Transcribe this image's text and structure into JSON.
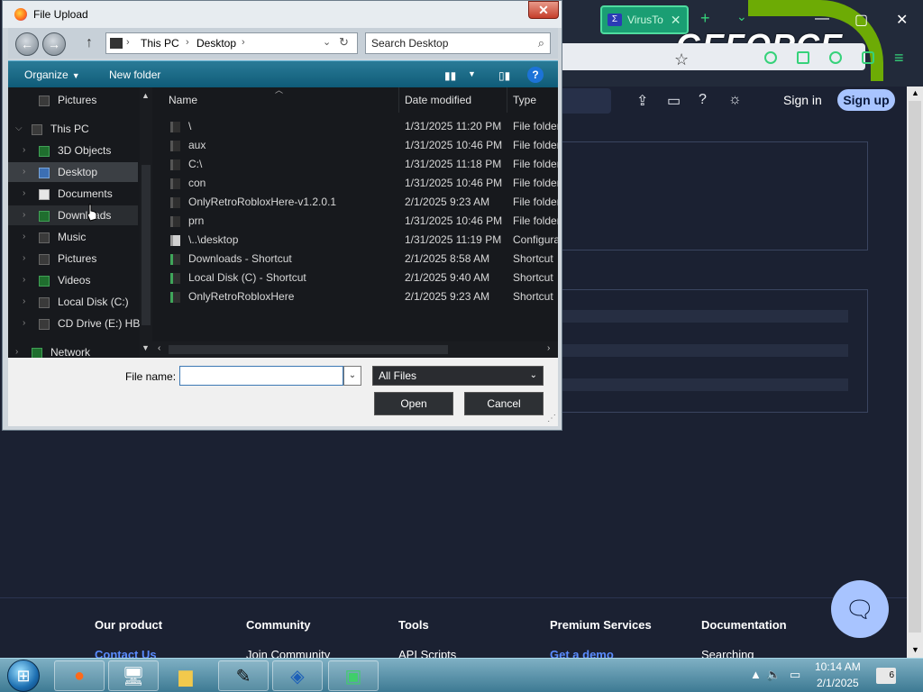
{
  "browser": {
    "tab_label": "VirusTo",
    "brand_text": "GEFORCE",
    "nav": {
      "sign_in": "Sign in",
      "sign_up": "Sign up"
    },
    "footer": {
      "columns": [
        {
          "heading": "Our product",
          "link": "Contact Us",
          "link_style": "blue"
        },
        {
          "heading": "Community",
          "link": "Join Community",
          "link_style": "white"
        },
        {
          "heading": "Tools",
          "link": "API Scripts",
          "link_style": "white"
        },
        {
          "heading": "Premium Services",
          "link": "Get a demo",
          "link_style": "blue"
        },
        {
          "heading": "Documentation",
          "link": "Searching",
          "link_style": "white"
        }
      ]
    }
  },
  "dialog": {
    "title": "File Upload",
    "path": [
      "This PC",
      "Desktop"
    ],
    "search_placeholder": "Search Desktop",
    "toolbar": {
      "organize": "Organize",
      "new_folder": "New folder"
    },
    "nav_tree": [
      {
        "label": "Pictures",
        "icon": "pictures-folder-icon",
        "level": 1,
        "chevron": false,
        "state": ""
      },
      {
        "label": "This PC",
        "icon": "computer-icon",
        "level": 0,
        "chevron": "v",
        "state": ""
      },
      {
        "label": "3D Objects",
        "icon": "3d-objects-icon",
        "level": 1,
        "chevron": ">",
        "state": ""
      },
      {
        "label": "Desktop",
        "icon": "desktop-icon",
        "level": 1,
        "chevron": ">",
        "state": "selected"
      },
      {
        "label": "Documents",
        "icon": "documents-icon",
        "level": 1,
        "chevron": ">",
        "state": ""
      },
      {
        "label": "Downloads",
        "icon": "downloads-icon",
        "level": 1,
        "chevron": ">",
        "state": "hover"
      },
      {
        "label": "Music",
        "icon": "music-icon",
        "level": 1,
        "chevron": ">",
        "state": ""
      },
      {
        "label": "Pictures",
        "icon": "pictures-folder-icon",
        "level": 1,
        "chevron": ">",
        "state": ""
      },
      {
        "label": "Videos",
        "icon": "videos-icon",
        "level": 1,
        "chevron": ">",
        "state": ""
      },
      {
        "label": "Local Disk (C:)",
        "icon": "disk-icon",
        "level": 1,
        "chevron": ">",
        "state": ""
      },
      {
        "label": "CD Drive (E:) HB",
        "icon": "cd-drive-icon",
        "level": 1,
        "chevron": ">",
        "state": ""
      },
      {
        "label": "Network",
        "icon": "network-icon",
        "level": 0,
        "chevron": ">",
        "state": ""
      }
    ],
    "columns": {
      "name": "Name",
      "date": "Date modified",
      "type": "Type"
    },
    "files": [
      {
        "name": "\\",
        "date": "1/31/2025 11:20 PM",
        "type": "File folder",
        "icon": "folder"
      },
      {
        "name": "aux",
        "date": "1/31/2025 10:46 PM",
        "type": "File folder",
        "icon": "folder"
      },
      {
        "name": "C:\\",
        "date": "1/31/2025 11:18 PM",
        "type": "File folder",
        "icon": "folder"
      },
      {
        "name": "con",
        "date": "1/31/2025 10:46 PM",
        "type": "File folder",
        "icon": "folder"
      },
      {
        "name": "OnlyRetroRobloxHere-v1.2.0.1",
        "date": "2/1/2025 9:23 AM",
        "type": "File folder",
        "icon": "folder"
      },
      {
        "name": "prn",
        "date": "1/31/2025 10:46 PM",
        "type": "File folder",
        "icon": "folder"
      },
      {
        "name": "\\..\\desktop",
        "date": "1/31/2025 11:19 PM",
        "type": "Configura",
        "icon": "config"
      },
      {
        "name": "Downloads - Shortcut",
        "date": "2/1/2025 8:58 AM",
        "type": "Shortcut",
        "icon": "shortcut"
      },
      {
        "name": "Local Disk (C) - Shortcut",
        "date": "2/1/2025 9:40 AM",
        "type": "Shortcut",
        "icon": "shortcut"
      },
      {
        "name": "OnlyRetroRobloxHere",
        "date": "2/1/2025 9:23 AM",
        "type": "Shortcut",
        "icon": "shortcut"
      }
    ],
    "file_name_label": "File name:",
    "file_name_value": "",
    "file_type": "All Files",
    "open_button": "Open",
    "cancel_button": "Cancel"
  },
  "taskbar": {
    "time": "10:14 AM",
    "date": "2/1/2025",
    "notification_count": "6",
    "pinned": [
      "firefox-icon",
      "remote-desktop-icon",
      "file-explorer-icon",
      "pen-icon",
      "virtualbox-icon",
      "terminal-icon"
    ]
  },
  "colors": {
    "accent_green": "#76b900",
    "signup": "#a8c4ff",
    "link_blue": "#5a8cff",
    "dialog_cmdbar": "#0f5b78"
  }
}
